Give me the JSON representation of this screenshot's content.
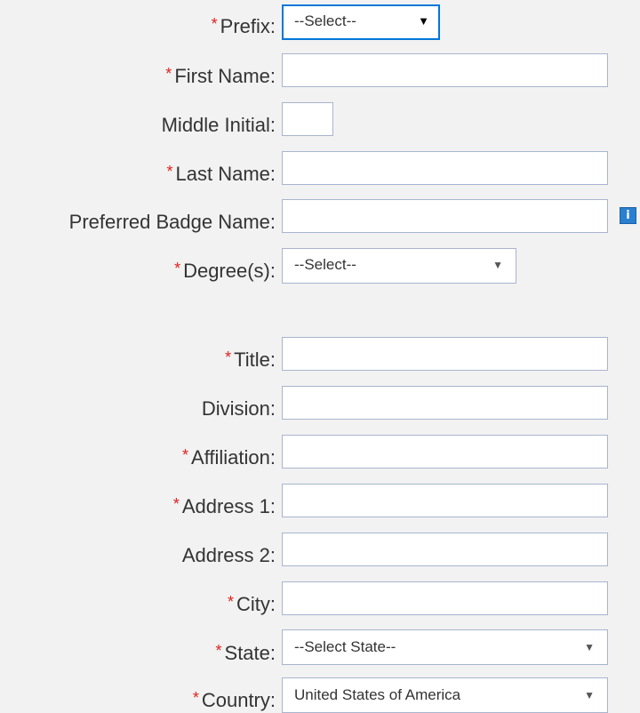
{
  "form": {
    "required_marker": "*",
    "prefix": {
      "label": "Prefix:",
      "selected": "--Select--"
    },
    "first_name": {
      "label": "First Name:",
      "value": ""
    },
    "middle_initial": {
      "label": "Middle Initial:",
      "value": ""
    },
    "last_name": {
      "label": "Last Name:",
      "value": ""
    },
    "badge_name": {
      "label": "Preferred Badge Name:",
      "value": ""
    },
    "degree": {
      "label": "Degree(s):",
      "selected": "--Select--"
    },
    "title": {
      "label": "Title:",
      "value": ""
    },
    "division": {
      "label": "Division:",
      "value": ""
    },
    "affiliation": {
      "label": "Affiliation:",
      "value": ""
    },
    "address1": {
      "label": "Address 1:",
      "value": ""
    },
    "address2": {
      "label": "Address 2:",
      "value": ""
    },
    "city": {
      "label": "City:",
      "value": ""
    },
    "state": {
      "label": "State:",
      "selected": "--Select State--"
    },
    "country": {
      "label": "Country:",
      "selected": "United States of America"
    }
  },
  "icons": {
    "dropdown_arrow": "▼",
    "info_glyph": "i"
  },
  "colors": {
    "required": "#e02020",
    "focus_border": "#0078d7",
    "info_icon": "#2b7fd1"
  }
}
